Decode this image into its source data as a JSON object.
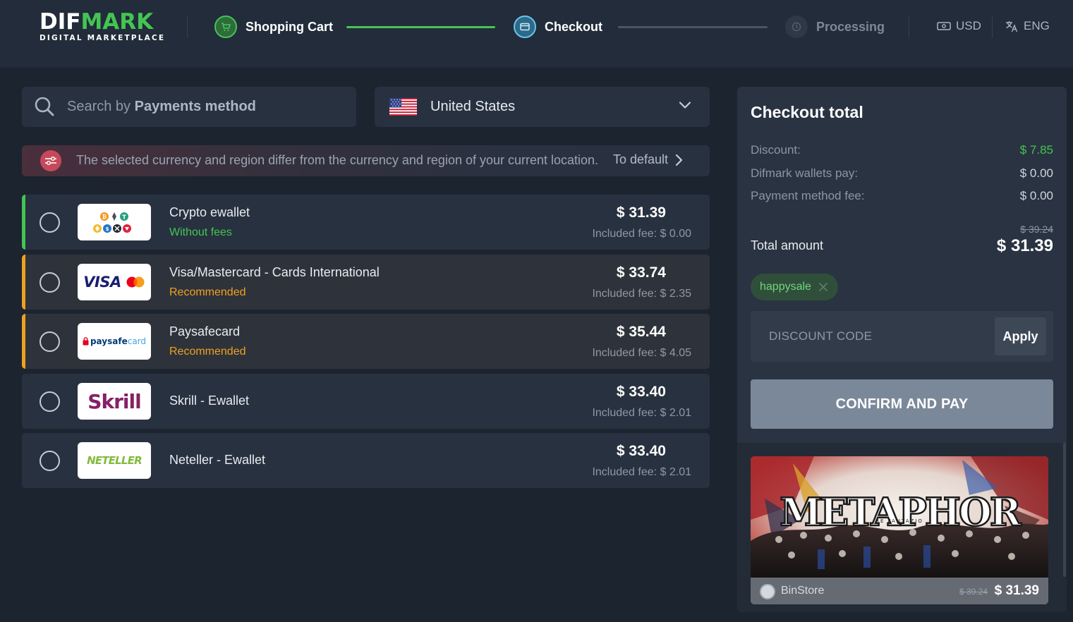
{
  "header": {
    "logo": {
      "main_plain": "DIF",
      "main_accent": "MARK",
      "sub": "DIGITAL MARKETPLACE"
    },
    "steps": [
      {
        "label": "Shopping Cart",
        "state": "done",
        "icon": "cart-icon"
      },
      {
        "label": "Checkout",
        "state": "active",
        "icon": "card-icon"
      },
      {
        "label": "Processing",
        "state": "pending",
        "icon": "clock-icon"
      }
    ],
    "currency": "USD",
    "language": "ENG"
  },
  "search": {
    "placeholder_prefix": "Search by ",
    "placeholder_bold": "Payments method"
  },
  "country": {
    "name": "United States",
    "flag": "us-flag-icon"
  },
  "notice": {
    "text": "The selected currency and region differ from the currency and region of your current location.",
    "link": "To default"
  },
  "payment_methods": [
    {
      "name": "Crypto ewallet",
      "tag": "Without fees",
      "tag_color": "#44c553",
      "bar_color": "#44c553",
      "price": "$ 31.39",
      "fee": "Included fee: $ 0.00",
      "logo": "crypto-logo"
    },
    {
      "name": "Visa/Mastercard - Cards International",
      "tag": "Recommended",
      "tag_color": "#f0a020",
      "bar_color": "#f0a020",
      "price": "$ 33.74",
      "fee": "Included fee: $ 2.35",
      "logo": "visa-mastercard-logo"
    },
    {
      "name": "Paysafecard",
      "tag": "Recommended",
      "tag_color": "#f0a020",
      "bar_color": "#f0a020",
      "price": "$ 35.44",
      "fee": "Included fee: $ 4.05",
      "logo": "paysafecard-logo"
    },
    {
      "name": "Skrill - Ewallet",
      "tag": "",
      "price": "$ 33.40",
      "fee": "Included fee: $ 2.01",
      "logo": "skrill-logo"
    },
    {
      "name": "Neteller - Ewallet",
      "tag": "",
      "price": "$ 33.40",
      "fee": "Included fee: $ 2.01",
      "logo": "neteller-logo"
    }
  ],
  "logos": {
    "visa": "VISA",
    "paysafe_bold": "paysafe",
    "paysafe_light": "card",
    "skrill": "Skrill",
    "neteller": "NETELLER"
  },
  "checkout": {
    "title": "Checkout total",
    "rows": [
      {
        "label": "Discount:",
        "value": "$ 7.85"
      },
      {
        "label": "Difmark wallets pay:",
        "value": "$ 0.00"
      },
      {
        "label": "Payment method fee:",
        "value": "$ 0.00"
      }
    ],
    "old_total": "$ 39.24",
    "total_label": "Total amount",
    "total_value": "$ 31.39",
    "promo_code": "happysale",
    "discount_placeholder": "DISCOUNT CODE",
    "apply_label": "Apply",
    "confirm_label": "CONFIRM AND PAY"
  },
  "product": {
    "title_art": "METAPHOR",
    "subtitle_art": "RE FANTAZIO",
    "store": "BinStore",
    "old_price": "$ 39.24",
    "price": "$ 31.39"
  },
  "colors": {
    "accent_green": "#44c553",
    "recommended_orange": "#f0a020",
    "background": "#1c2430",
    "panel": "#2a3341"
  }
}
